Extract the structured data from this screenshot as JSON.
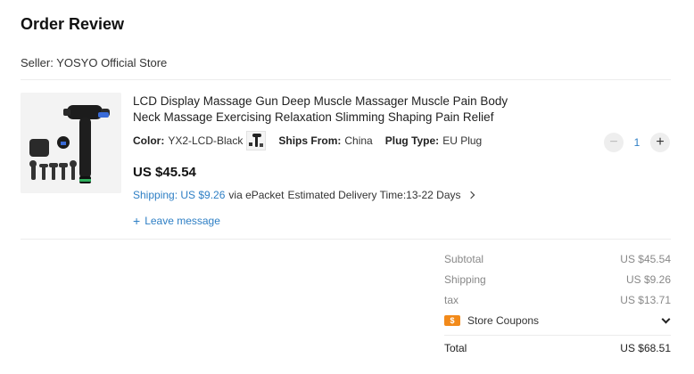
{
  "page": {
    "title": "Order Review"
  },
  "seller": {
    "text": "Seller: YOSYO Official Store"
  },
  "item": {
    "title": "LCD Display Massage Gun Deep Muscle Massager Muscle Pain Body Neck Massage Exercising Relaxation Slimming Shaping Pain Relief",
    "color_label": "Color:",
    "color_value": "YX2-LCD-Black",
    "ships_label": "Ships From:",
    "ships_value": "China",
    "plug_label": "Plug Type:",
    "plug_value": "EU Plug",
    "price": "US $45.54",
    "shipping_cost": "Shipping: US $9.26",
    "shipping_method": "via ePacket",
    "delivery": "Estimated Delivery Time:13-22 Days",
    "leave_message": "Leave message",
    "quantity": "1"
  },
  "summary": {
    "subtotal_label": "Subtotal",
    "subtotal_value": "US $45.54",
    "shipping_label": "Shipping",
    "shipping_value": "US $9.26",
    "tax_label": "tax",
    "tax_value": "US $13.71",
    "coupons_label": "Store Coupons",
    "total_label": "Total",
    "total_value": "US $68.51"
  },
  "icons": {
    "product": "massage-gun-product-image",
    "variant": "variant-thumbnail",
    "chevron": "chevron-right-icon",
    "coupon": "coupon-icon",
    "dropdown": "chevron-down-icon"
  },
  "colors": {
    "accent": "#2e7fc5",
    "coupon": "#f28a1a"
  }
}
